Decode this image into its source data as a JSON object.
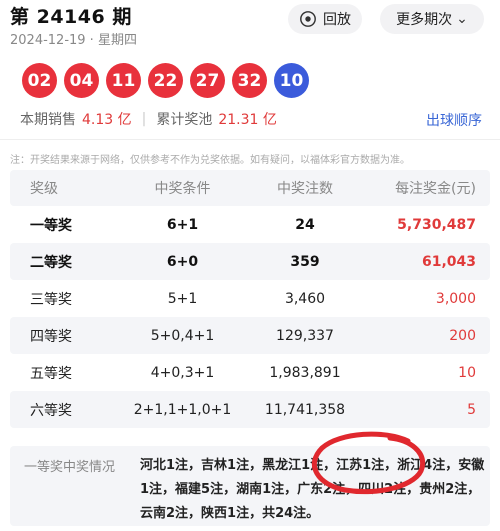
{
  "header": {
    "issue": "第 24146 期",
    "date_line": "2024-12-19  ·  星期四",
    "replay_label": "回放",
    "more_label": "更多期次",
    "icons": {
      "replay": "replay-icon",
      "more": "chevron-down-icon"
    }
  },
  "draw": {
    "red_balls": [
      "02",
      "04",
      "11",
      "22",
      "27",
      "32"
    ],
    "blue_ball": "10",
    "colors": {
      "red": "#e8313c",
      "blue": "#3b5bdb"
    }
  },
  "sales": {
    "sales_label": "本期销售",
    "sales_value": "4.13 亿",
    "pool_label": "累计奖池",
    "pool_value": "21.31 亿",
    "order_link": "出球顺序"
  },
  "note": "注：开奖结果来源于网络，仅供参考不作为兑奖依据。如有疑问，以福体彩官方数据为准。",
  "table": {
    "headers": [
      "奖级",
      "中奖条件",
      "中奖注数",
      "每注奖金(元)"
    ],
    "rows": [
      {
        "level": "一等奖",
        "condition": "6+1",
        "count": "24",
        "prize": "5,730,487"
      },
      {
        "level": "二等奖",
        "condition": "6+0",
        "count": "359",
        "prize": "61,043"
      },
      {
        "level": "三等奖",
        "condition": "5+1",
        "count": "3,460",
        "prize": "3,000"
      },
      {
        "level": "四等奖",
        "condition": "5+0,4+1",
        "count": "129,337",
        "prize": "200"
      },
      {
        "level": "五等奖",
        "condition": "4+0,3+1",
        "count": "1,983,891",
        "prize": "10"
      },
      {
        "level": "六等奖",
        "condition": "2+1,1+1,0+1",
        "count": "11,741,358",
        "prize": "5"
      }
    ]
  },
  "winners": {
    "label": "一等奖中奖情况",
    "text": "河北1注，吉林1注，黑龙江1注，江苏1注，浙江4注，安徽1注，福建5注，湖南1注，广东2注，四川2注，贵州2注，云南2注，陕西1注，共24注。"
  },
  "accent_colors": {
    "prize": "#e03a3a",
    "link": "#3a67d6",
    "annotation": "#e0282e"
  }
}
